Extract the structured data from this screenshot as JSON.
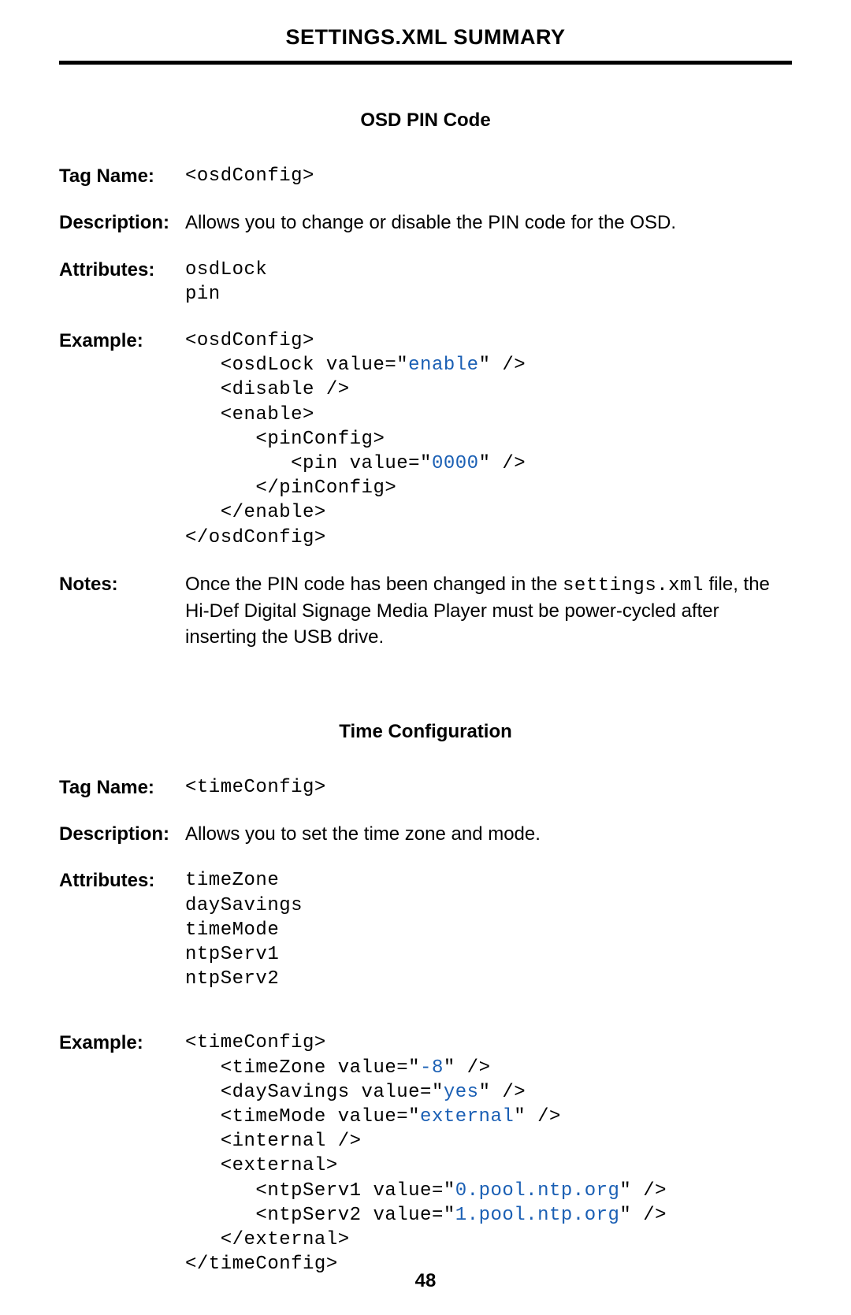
{
  "header": "SETTINGS.XML SUMMARY",
  "page_number": "48",
  "labels": {
    "tag_name": "Tag Name",
    "description": "Description",
    "attributes": "Attributes",
    "example": "Example",
    "notes": "Notes:"
  },
  "section1": {
    "title": "OSD PIN Code",
    "tag_name": "<osdConfig>",
    "description": "Allows you to change or disable the PIN code for the OSD.",
    "attributes": [
      "osdLock",
      "pin"
    ],
    "example": {
      "l1": "<osdConfig>",
      "l2a": "   <osdLock value=\"",
      "l2v": "enable",
      "l2b": "\" />",
      "l3": "   <disable />",
      "l4": "   <enable>",
      "l5": "      <pinConfig>",
      "l6a": "         <pin value=\"",
      "l6v": "0000",
      "l6b": "\" />",
      "l7": "      </pinConfig>",
      "l8": "   </enable>",
      "l9": "</osdConfig>"
    },
    "notes_pre": "Once the PIN code has been changed in the ",
    "notes_mono": "settings.xml",
    "notes_post": " file, the Hi-Def Digital Signage Media Player must be power-cycled after inserting the USB drive."
  },
  "section2": {
    "title": "Time Configuration",
    "tag_name": "<timeConfig>",
    "description": "Allows you to set the time zone and mode.",
    "attributes": [
      "timeZone",
      "daySavings",
      "timeMode",
      "ntpServ1",
      "ntpServ2"
    ],
    "example": {
      "l1": "<timeConfig>",
      "l2a": "   <timeZone value=\"",
      "l2v": "-8",
      "l2b": "\" />",
      "l3a": "   <daySavings value=\"",
      "l3v": "yes",
      "l3b": "\" />",
      "l4a": "   <timeMode value=\"",
      "l4v": "external",
      "l4b": "\" />",
      "l5": "   <internal />",
      "l6": "   <external>",
      "l7a": "      <ntpServ1 value=\"",
      "l7v": "0.pool.ntp.org",
      "l7b": "\" />",
      "l8a": "      <ntpServ2 value=\"",
      "l8v": "1.pool.ntp.org",
      "l8b": "\" />",
      "l9": "   </external>",
      "l10": "</timeConfig>"
    }
  }
}
